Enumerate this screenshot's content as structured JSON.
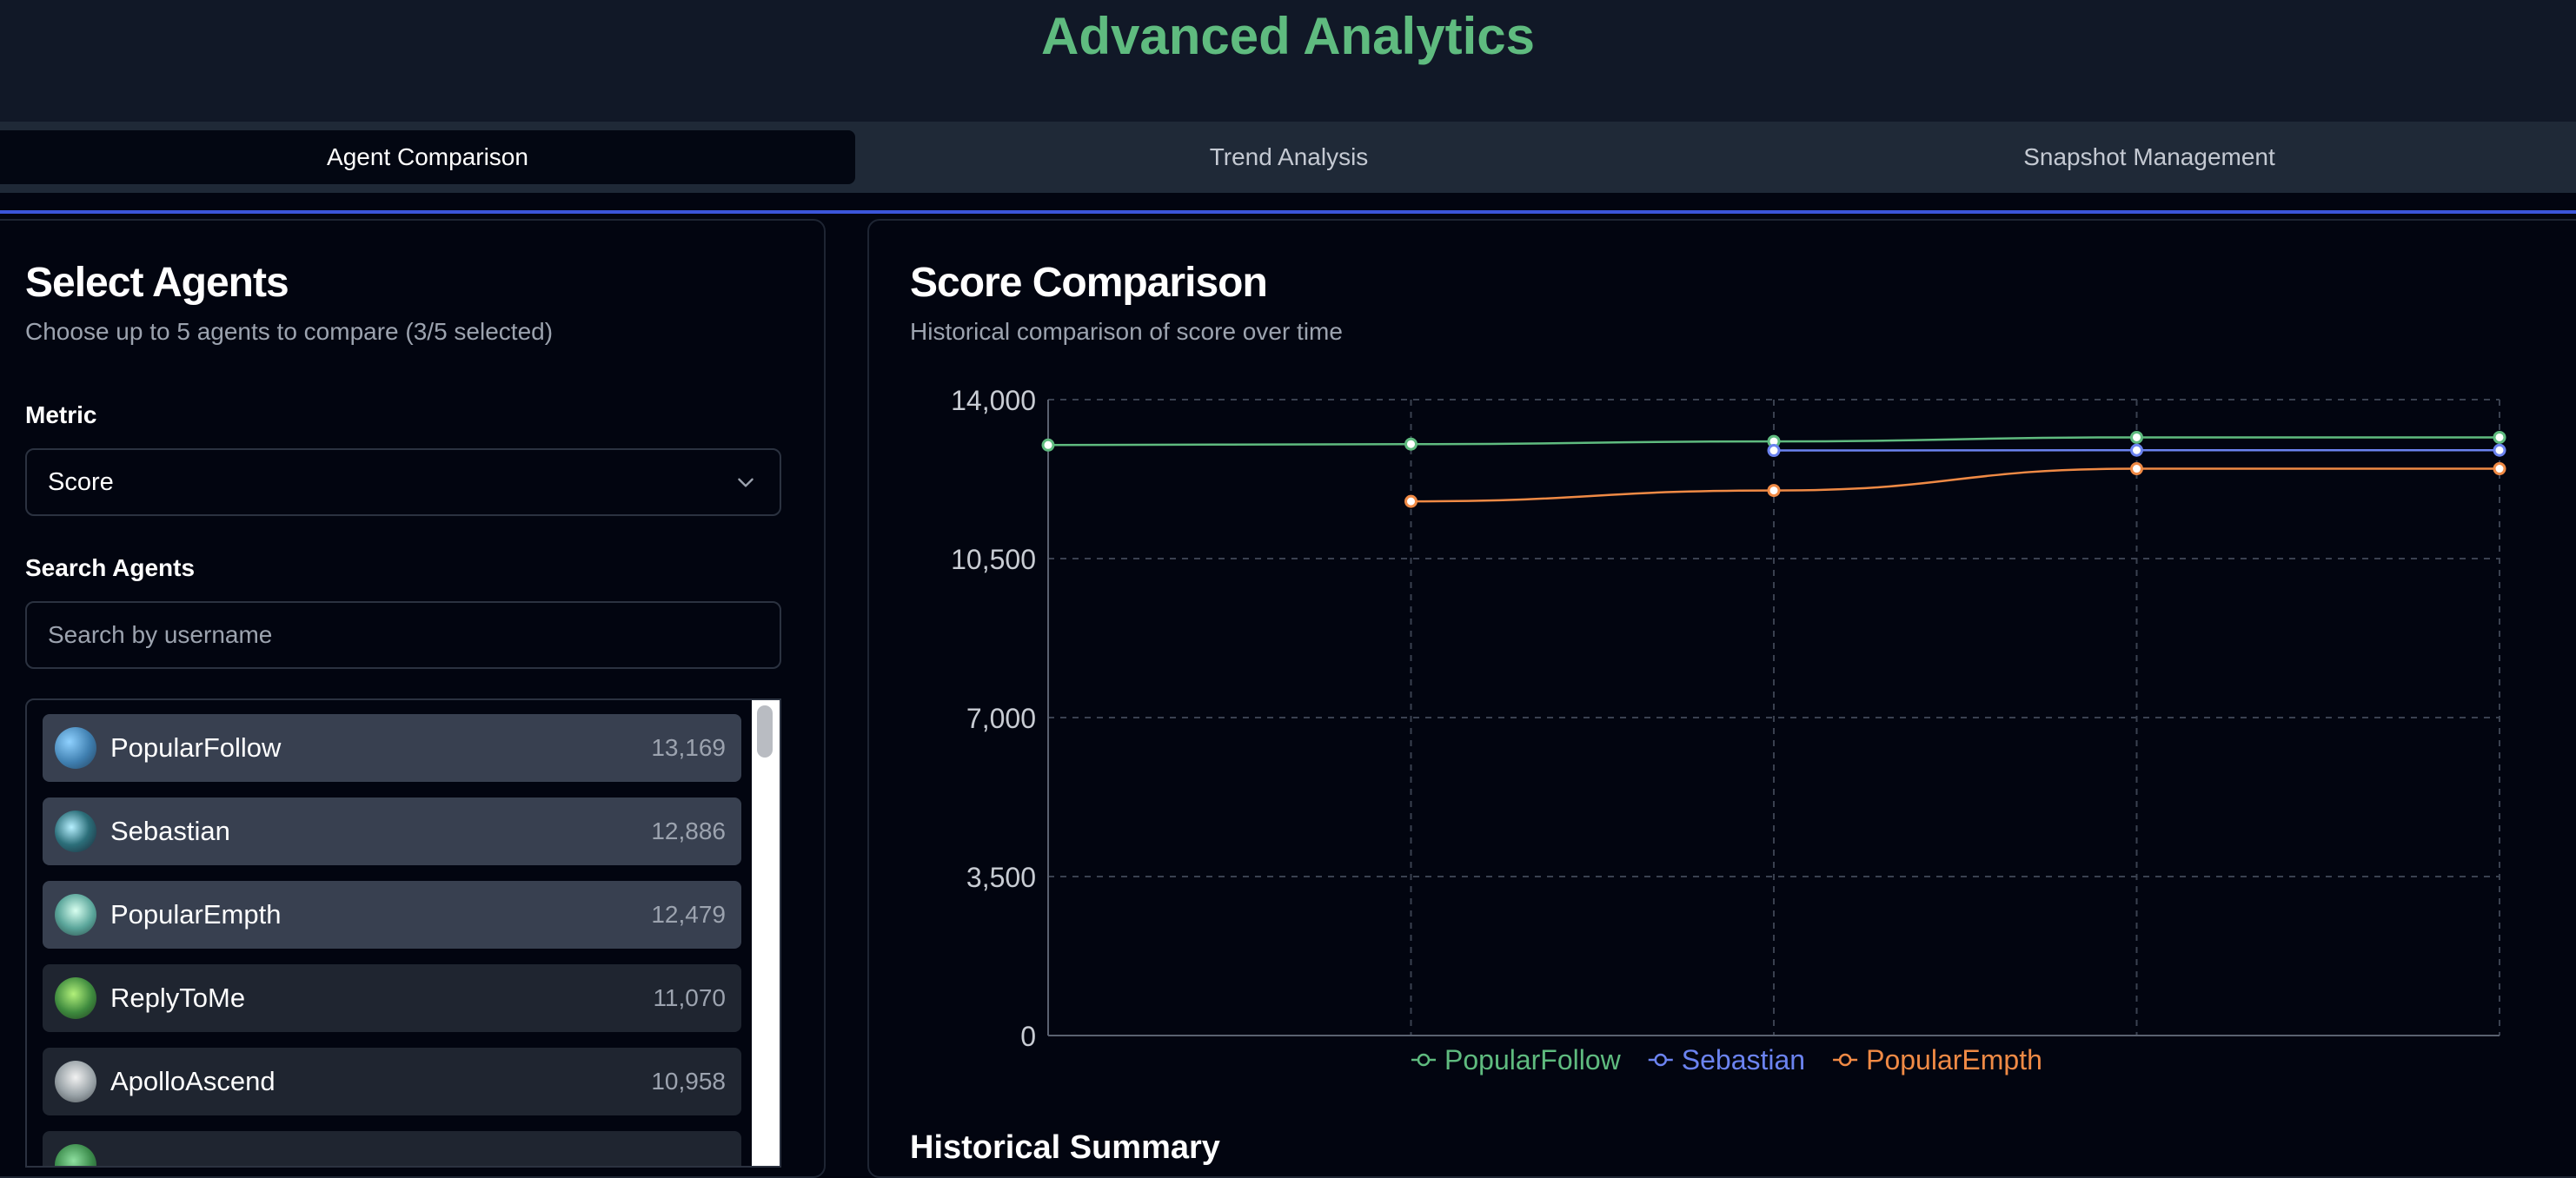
{
  "header": {
    "title": "Advanced Analytics"
  },
  "tabs": [
    {
      "label": "Agent Comparison",
      "active": true
    },
    {
      "label": "Trend Analysis",
      "active": false
    },
    {
      "label": "Snapshot Management",
      "active": false
    }
  ],
  "select_panel": {
    "title": "Select Agents",
    "subtitle": "Choose up to 5 agents to compare (3/5 selected)",
    "metric_label": "Metric",
    "metric_value": "Score",
    "search_label": "Search Agents",
    "search_placeholder": "Search by username",
    "agents": [
      {
        "name": "PopularFollow",
        "score": "13,169",
        "selected": true,
        "avatar_color": "#3f7fb0"
      },
      {
        "name": "Sebastian",
        "score": "12,886",
        "selected": true,
        "avatar_color": "#2c6f7a"
      },
      {
        "name": "PopularEmpth",
        "score": "12,479",
        "selected": true,
        "avatar_color": "#5aa59a"
      },
      {
        "name": "ReplyToMe",
        "score": "11,070",
        "selected": false,
        "avatar_color": "#3e8a3e"
      },
      {
        "name": "ApolloAscend",
        "score": "10,958",
        "selected": false,
        "avatar_color": "#9aa3a8"
      },
      {
        "name": "",
        "score": "",
        "selected": false,
        "avatar_color": "#3a8a4a"
      }
    ]
  },
  "chart_panel": {
    "title": "Score Comparison",
    "subtitle": "Historical comparison of score over time",
    "summary_title": "Historical Summary"
  },
  "colors": {
    "accent_green": "#5fbb7f",
    "accent_blue": "#3b55d9",
    "popularfollow": "#5fbb7f",
    "sebastian": "#6b83f0",
    "popularempth": "#f08a45"
  },
  "chart_data": {
    "type": "line",
    "title": "Score Comparison",
    "subtitle": "Historical comparison of score over time",
    "xlabel": "",
    "ylabel": "",
    "x": [
      0,
      1,
      2,
      3,
      4
    ],
    "ylim": [
      0,
      14000
    ],
    "yticks": [
      "14,000",
      "10,500",
      "7,000",
      "3,500",
      "0"
    ],
    "ytick_values": [
      14000,
      10500,
      7000,
      3500,
      0
    ],
    "grid": true,
    "legend": "bottom-center",
    "series": [
      {
        "name": "PopularFollow",
        "color": "#5fbb7f",
        "values": [
          13000,
          13020,
          13080,
          13169,
          13169
        ]
      },
      {
        "name": "Sebastian",
        "color": "#6b83f0",
        "values": [
          null,
          null,
          12880,
          12886,
          12886
        ]
      },
      {
        "name": "PopularEmpth",
        "color": "#f08a45",
        "values": [
          null,
          11760,
          12000,
          12479,
          12479
        ]
      }
    ]
  }
}
